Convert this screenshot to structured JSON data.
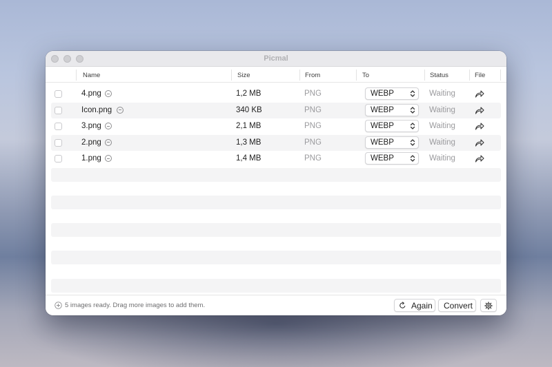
{
  "window": {
    "title": "Picmal"
  },
  "columns": {
    "name": "Name",
    "size": "Size",
    "from": "From",
    "to": "To",
    "status": "Status",
    "file": "File"
  },
  "files": [
    {
      "name": "4.png",
      "size": "1,2 MB",
      "from": "PNG",
      "to": "WEBP",
      "status": "Waiting"
    },
    {
      "name": "Icon.png",
      "size": "340 KB",
      "from": "PNG",
      "to": "WEBP",
      "status": "Waiting"
    },
    {
      "name": "3.png",
      "size": "2,1 MB",
      "from": "PNG",
      "to": "WEBP",
      "status": "Waiting"
    },
    {
      "name": "2.png",
      "size": "1,3 MB",
      "from": "PNG",
      "to": "WEBP",
      "status": "Waiting"
    },
    {
      "name": "1.png",
      "size": "1,4 MB",
      "from": "PNG",
      "to": "WEBP",
      "status": "Waiting"
    }
  ],
  "footer": {
    "message": "5 images ready. Drag more images to add them.",
    "again_label": "Again",
    "convert_label": "Convert"
  },
  "icons": {
    "remove": "minus-circle-icon",
    "format_select": "chevron-up-down-icon",
    "share": "share-arrow-icon",
    "add": "plus-circle-icon",
    "again": "refresh-icon",
    "settings": "gear-icon"
  }
}
